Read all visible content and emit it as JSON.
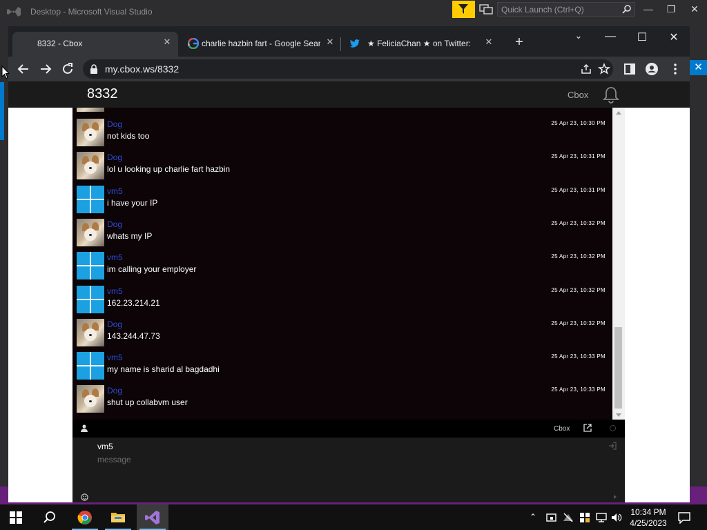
{
  "vs": {
    "title": "Desktop - Microsoft Visual Studio",
    "quick_launch_placeholder": "Quick Launch (Ctrl+Q)"
  },
  "browser": {
    "tabs": [
      {
        "title": "8332 - Cbox",
        "favicon": "none",
        "active": true
      },
      {
        "title": "charlie hazbin fart - Google Sear",
        "favicon": "google-icon",
        "active": false
      },
      {
        "title": "★ FeliciaChan ★ on Twitter: \"@",
        "favicon": "twitter-icon",
        "active": false
      }
    ],
    "url": "my.cbox.ws/8332"
  },
  "page": {
    "box_name": "8332",
    "brand": "Cbox"
  },
  "messages": [
    {
      "user": "Dog",
      "avatar": "dog",
      "text": "not kids too",
      "time": "25 Apr 23, 10:30 PM"
    },
    {
      "user": "Dog",
      "avatar": "dog",
      "text": "lol u looking up charlie fart hazbin",
      "time": "25 Apr 23, 10:31 PM"
    },
    {
      "user": "vm5",
      "avatar": "windows",
      "text": "i have your IP",
      "time": "25 Apr 23, 10:31 PM"
    },
    {
      "user": "Dog",
      "avatar": "dog",
      "text": "whats my IP",
      "time": "25 Apr 23, 10:32 PM"
    },
    {
      "user": "vm5",
      "avatar": "windows",
      "text": "im calling your employer",
      "time": "25 Apr 23, 10:32 PM"
    },
    {
      "user": "vm5",
      "avatar": "windows",
      "text": "162.23.214.21",
      "time": "25 Apr 23, 10:32 PM"
    },
    {
      "user": "Dog",
      "avatar": "dog",
      "text": "143.244.47.73",
      "time": "25 Apr 23, 10:32 PM"
    },
    {
      "user": "vm5",
      "avatar": "windows",
      "text": "my name is sharid al bagdadhi",
      "time": "25 Apr 23, 10:33 PM"
    },
    {
      "user": "Dog",
      "avatar": "dog",
      "text": "shut up collabvm user",
      "time": "25 Apr 23, 10:33 PM"
    }
  ],
  "chatbar": {
    "brand": "Cbox"
  },
  "compose": {
    "username": "vm5",
    "placeholder": "message"
  },
  "taskbar": {
    "time": "10:34 PM",
    "date": "4/25/2023"
  },
  "colors": {
    "username_link": "#2f4bd8",
    "chat_bg": "#0c0406",
    "vs_accent": "#007acc",
    "vs_status": "#68217a"
  }
}
